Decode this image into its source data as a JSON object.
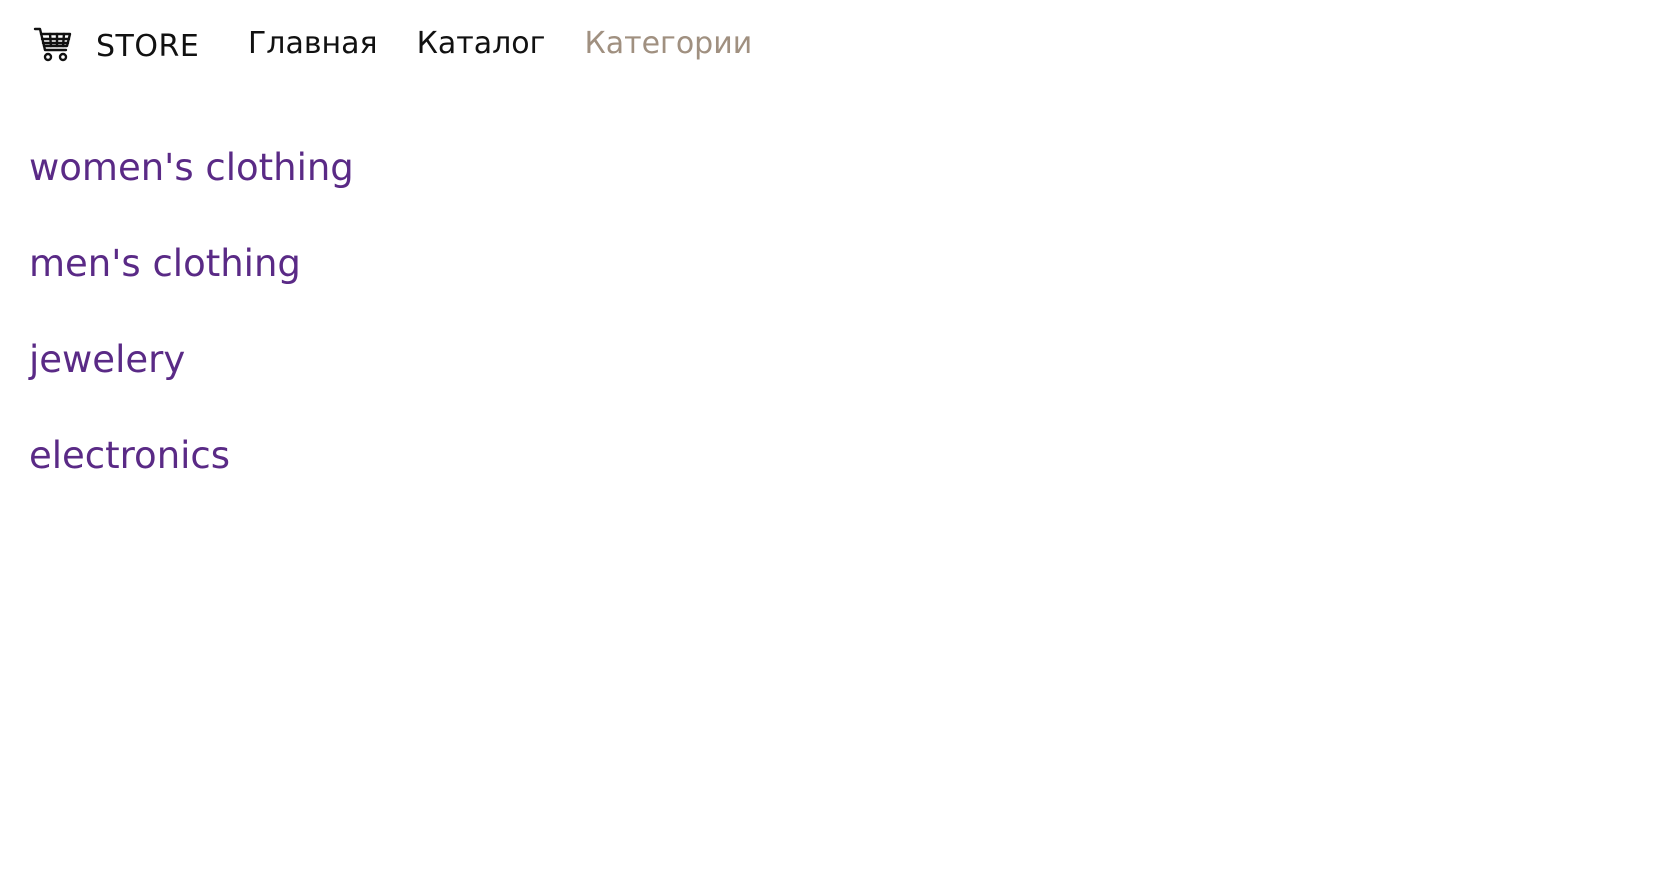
{
  "brand": {
    "icon": "shopping-cart-icon",
    "label": "STORE"
  },
  "nav": {
    "items": [
      {
        "label": "Главная",
        "active": false
      },
      {
        "label": "Каталог",
        "active": false
      },
      {
        "label": "Категории",
        "active": true
      }
    ],
    "active_color": "#a09080",
    "text_color": "#111111"
  },
  "categories": {
    "items": [
      {
        "label": "women's clothing"
      },
      {
        "label": "men's clothing"
      },
      {
        "label": "jewelery"
      },
      {
        "label": "electronics"
      }
    ],
    "link_color": "#5a2a86"
  }
}
